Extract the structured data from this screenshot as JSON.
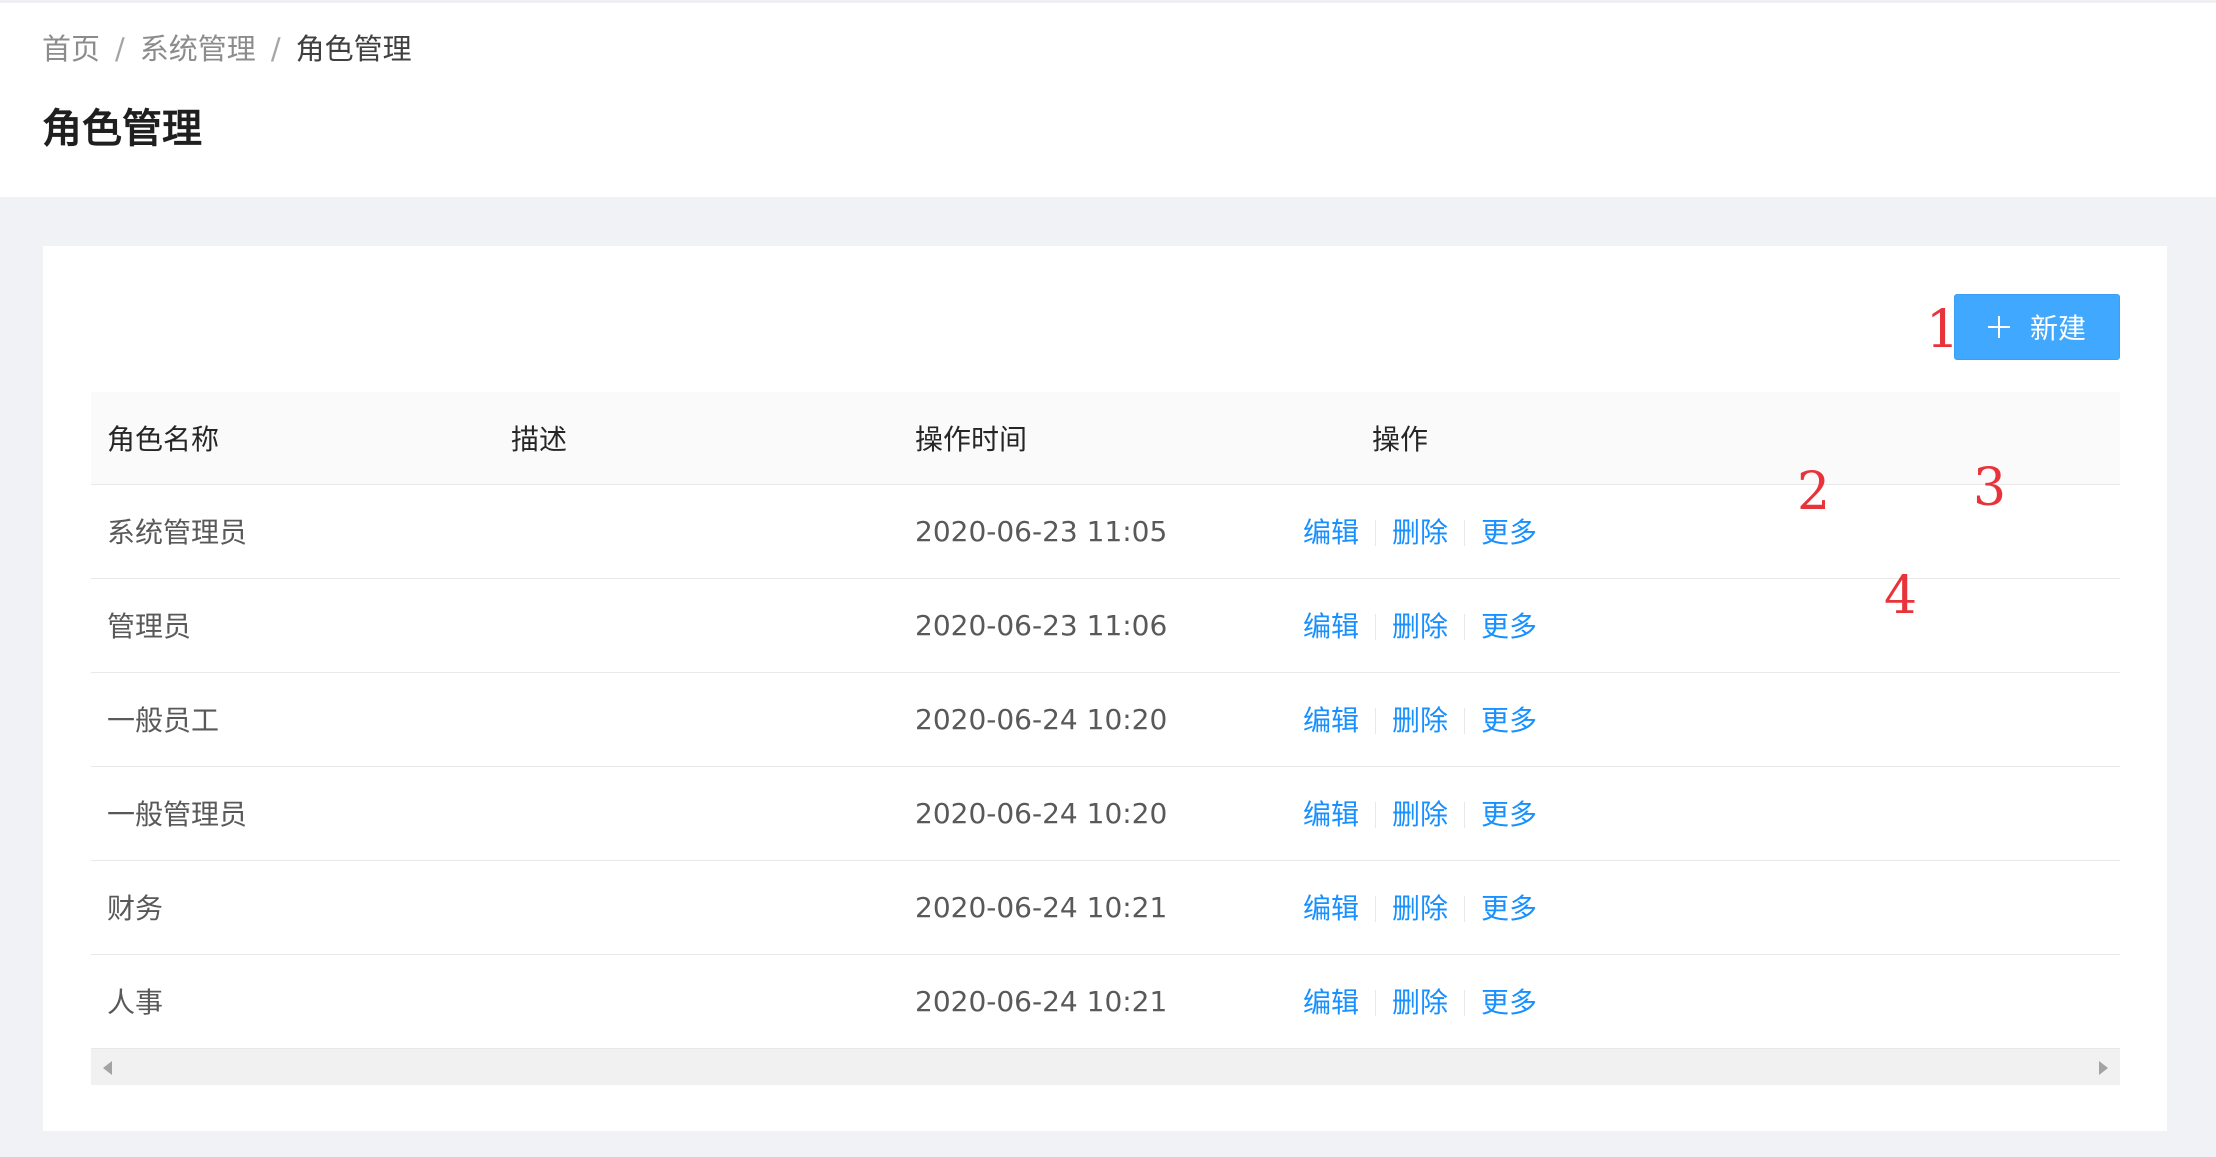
{
  "breadcrumb": {
    "items": [
      "首页",
      "系统管理",
      "角色管理"
    ],
    "separator": "/"
  },
  "page": {
    "title": "角色管理"
  },
  "toolbar": {
    "new_label": "新建"
  },
  "table": {
    "columns": [
      "角色名称",
      "描述",
      "操作时间",
      "操作"
    ],
    "rows": [
      {
        "name": "系统管理员",
        "description": "",
        "time": "2020-06-23 11:05"
      },
      {
        "name": "管理员",
        "description": "",
        "time": "2020-06-23 11:06"
      },
      {
        "name": "一般员工",
        "description": "",
        "time": "2020-06-24 10:20"
      },
      {
        "name": "一般管理员",
        "description": "",
        "time": "2020-06-24 10:20"
      },
      {
        "name": "财务",
        "description": "",
        "time": "2020-06-24 10:21"
      },
      {
        "name": "人事",
        "description": "",
        "time": "2020-06-24 10:21"
      }
    ],
    "actions": {
      "edit": "编辑",
      "delete": "删除",
      "more": "更多"
    }
  },
  "markers": [
    "1",
    "2",
    "3",
    "4"
  ],
  "colors": {
    "primary": "#1890ff",
    "button": "#40a9ff",
    "marker": "#e8333a",
    "background": "#f0f2f5"
  }
}
